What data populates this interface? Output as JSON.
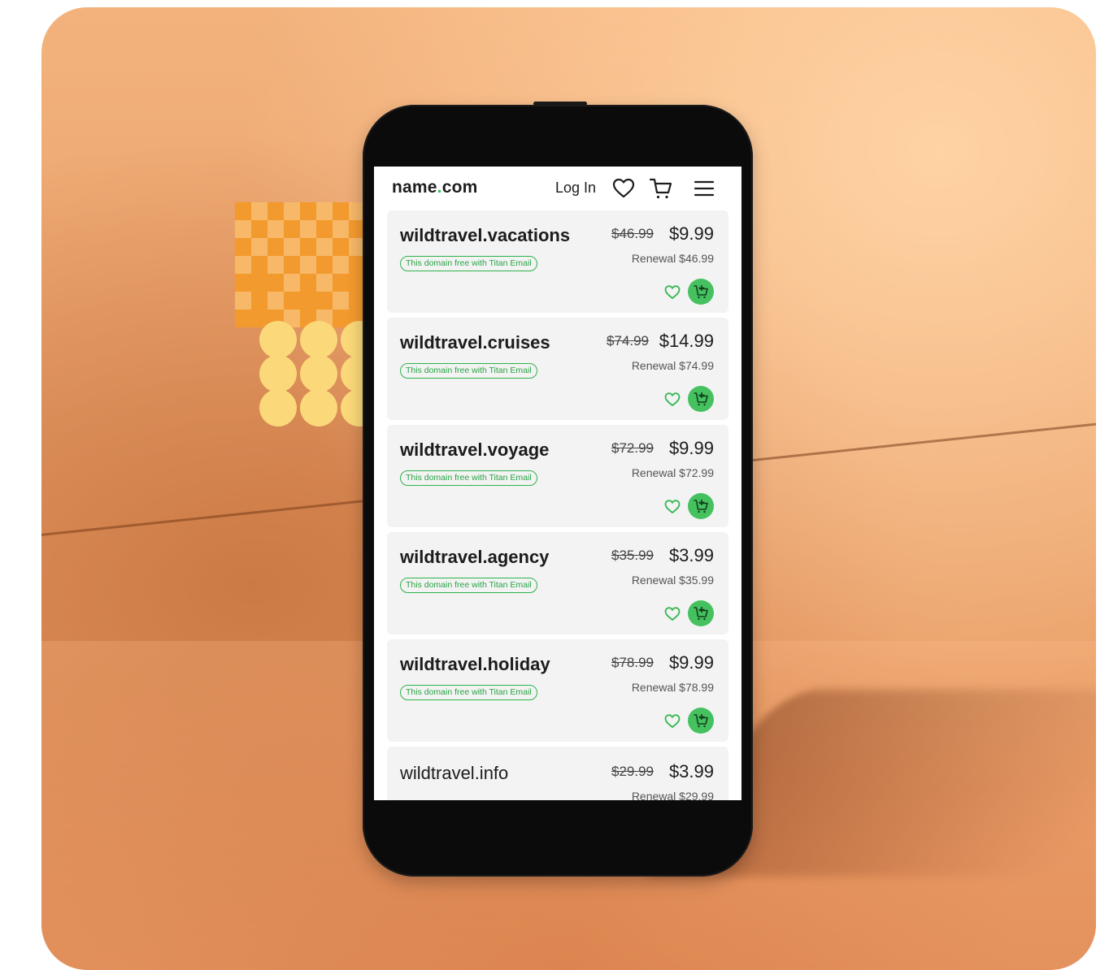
{
  "header": {
    "logo_text_a": "name",
    "logo_dot": ".",
    "logo_text_b": "com",
    "login_label": "Log In",
    "icons": [
      "heart-icon",
      "cart-icon",
      "menu-icon"
    ]
  },
  "listings": [
    {
      "domain": "wildtravel.vacations",
      "badge": "This domain free with Titan Email",
      "old_price": "$46.99",
      "price": "$9.99",
      "renewal": "Renewal $46.99"
    },
    {
      "domain": "wildtravel.cruises",
      "badge": "This domain free with Titan Email",
      "old_price": "$74.99",
      "price": "$14.99",
      "renewal": "Renewal $74.99"
    },
    {
      "domain": "wildtravel.voyage",
      "badge": "This domain free with Titan Email",
      "old_price": "$72.99",
      "price": "$9.99",
      "renewal": "Renewal $72.99"
    },
    {
      "domain": "wildtravel.agency",
      "badge": "This domain free with Titan Email",
      "old_price": "$35.99",
      "price": "$3.99",
      "renewal": "Renewal $35.99"
    },
    {
      "domain": "wildtravel.holiday",
      "badge": "This domain free with Titan Email",
      "old_price": "$78.99",
      "price": "$9.99",
      "renewal": "Renewal $78.99"
    },
    {
      "domain": "wildtravel.info",
      "badge": "",
      "old_price": "$29.99",
      "price": "$3.99",
      "renewal": "Renewal $29.99"
    }
  ],
  "colors": {
    "accent_green": "#45c15f",
    "badge_green": "#2db34a",
    "deco_orange": "#f39a2e",
    "deco_yellow": "#fbd879"
  }
}
